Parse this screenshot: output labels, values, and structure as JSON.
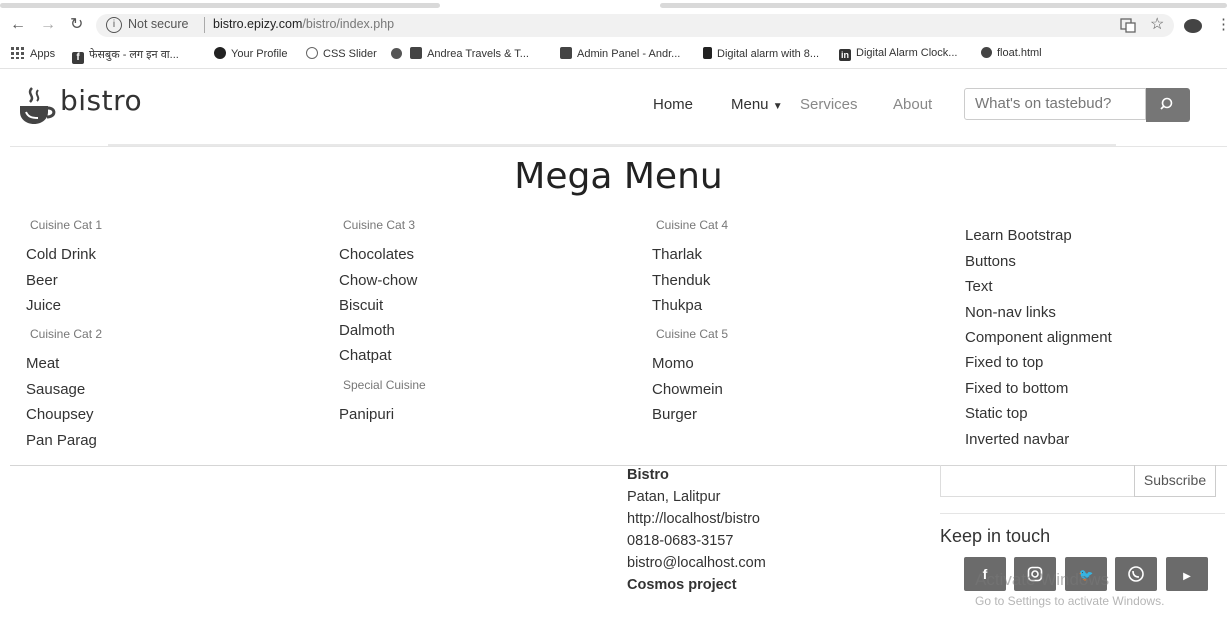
{
  "browser": {
    "security_label": "Not secure",
    "url_host": "bistro.epizy.com",
    "url_path": "/bistro/index.php",
    "bookmarks": [
      {
        "label": "Apps"
      },
      {
        "label": "फेसबुक - लग इन वा..."
      },
      {
        "label": "Your Profile"
      },
      {
        "label": "CSS Slider"
      },
      {
        "label": "Andrea Travels & T..."
      },
      {
        "label": "Admin Panel - Andr..."
      },
      {
        "label": "Digital alarm with 8..."
      },
      {
        "label": "Digital Alarm Clock..."
      },
      {
        "label": "float.html"
      }
    ]
  },
  "site": {
    "brand": "bistro",
    "nav": [
      {
        "label": "Home",
        "color": "#333333"
      },
      {
        "label": "Menu",
        "color": "#333333"
      },
      {
        "label": "Services",
        "color": "#888888"
      },
      {
        "label": "About",
        "color": "#888888"
      }
    ],
    "search_placeholder": "What's on tastebud?"
  },
  "mega_menu": {
    "title": "Mega Menu",
    "col1": {
      "cat1": "Cuisine Cat 1",
      "items1": [
        "Cold Drink",
        "Beer",
        "Juice"
      ],
      "cat2": "Cuisine Cat 2",
      "items2": [
        "Meat",
        "Sausage",
        "Choupsey",
        "Pan Parag"
      ]
    },
    "col2": {
      "cat1": "Cuisine Cat 3",
      "items1": [
        "Chocolates",
        "Chow-chow",
        "Biscuit",
        "Dalmoth",
        "Chatpat"
      ],
      "cat2": "Special Cuisine",
      "items2": [
        "Panipuri"
      ]
    },
    "col3": {
      "cat1": "Cuisine Cat 4",
      "items1": [
        "Tharlak",
        "Thenduk",
        "Thukpa"
      ],
      "cat2": "Cuisine Cat 5",
      "items2": [
        "Momo",
        "Chowmein",
        "Burger"
      ]
    },
    "col4": {
      "items": [
        "Learn Bootstrap",
        "Buttons",
        "Text",
        "Non-nav links",
        "Component alignment",
        "Fixed to top",
        "Fixed to bottom",
        "Static top",
        "Inverted navbar"
      ]
    }
  },
  "footer": {
    "name": "Bistro",
    "address": "Patan, Lalitpur",
    "website": "http://localhost/bistro",
    "phone": "0818-0683-3157",
    "email": "bistro@localhost.com",
    "project": "Cosmos project",
    "subscribe_label": "Subscribe",
    "keep_in_touch": "Keep in touch",
    "social_icons": [
      "facebook-icon",
      "instagram-icon",
      "twitter-icon",
      "whatsapp-icon",
      "youtube-icon"
    ]
  },
  "watermark": {
    "line1": "Activate Windows",
    "line2": "Go to Settings to activate Windows."
  }
}
